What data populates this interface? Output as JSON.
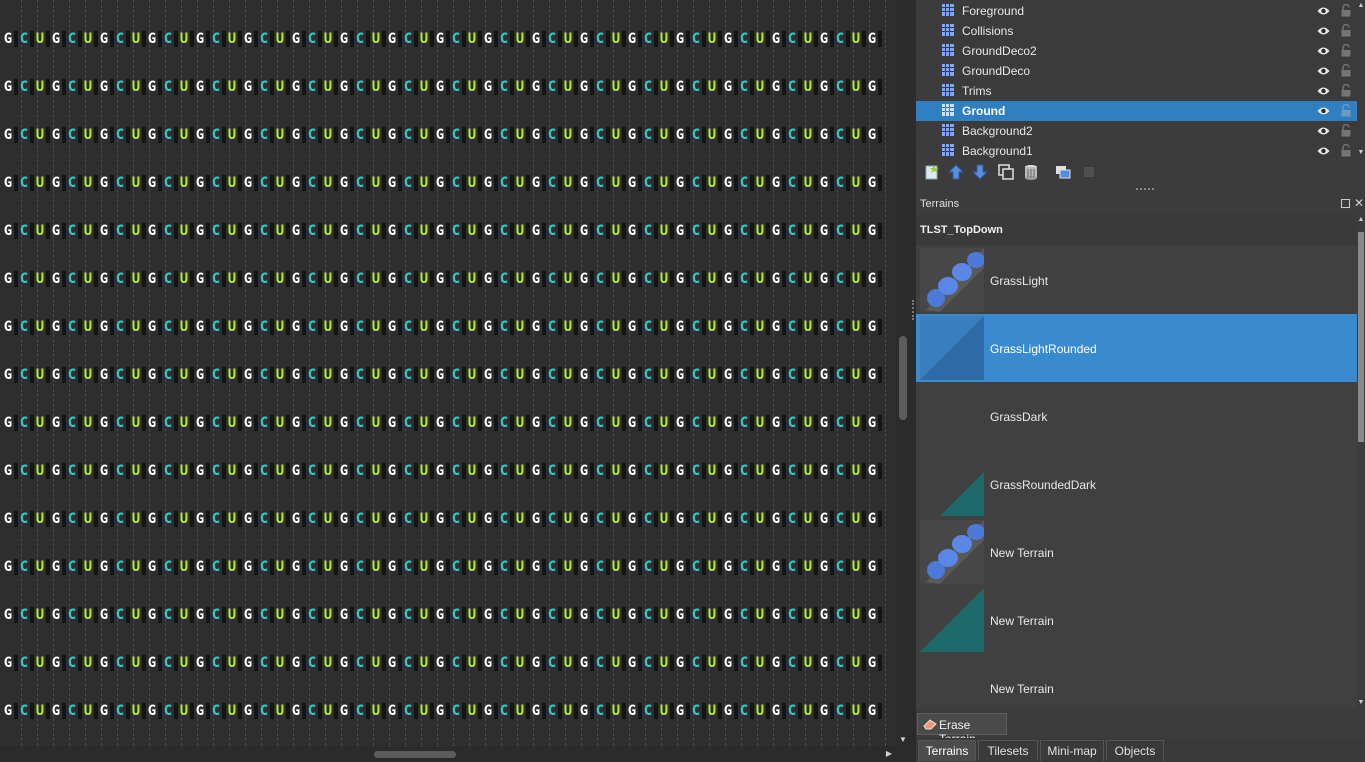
{
  "map": {
    "pattern": [
      "G",
      "C",
      "U"
    ],
    "row_count": 15,
    "triplet_count": 19
  },
  "layers": {
    "items": [
      {
        "name": "Foreground",
        "selected": false
      },
      {
        "name": "Collisions",
        "selected": false
      },
      {
        "name": "GroundDeco2",
        "selected": false
      },
      {
        "name": "GroundDeco",
        "selected": false
      },
      {
        "name": "Trims",
        "selected": false
      },
      {
        "name": "Ground",
        "selected": true
      },
      {
        "name": "Background2",
        "selected": false
      },
      {
        "name": "Background1",
        "selected": false
      }
    ]
  },
  "layer_toolbar": {
    "icons": [
      "new-layer-icon",
      "move-layer-up-icon",
      "move-layer-down-icon",
      "duplicate-layer-icon",
      "delete-layer-icon",
      "merge-layer-icon",
      "layer-properties-icon"
    ]
  },
  "terrains_panel": {
    "title": "Terrains",
    "tileset_name": "TLST_TopDown",
    "items": [
      {
        "name": "GrassLight",
        "thumb": "blob-blue",
        "selected": false
      },
      {
        "name": "GrassLightRounded",
        "thumb": "triangle-blue",
        "selected": true
      },
      {
        "name": "GrassDark",
        "thumb": "none",
        "selected": false
      },
      {
        "name": "GrassRoundedDark",
        "thumb": "triangle-teal-small",
        "selected": false
      },
      {
        "name": "New Terrain",
        "thumb": "blob-blue",
        "selected": false
      },
      {
        "name": "New Terrain",
        "thumb": "triangle-teal",
        "selected": false
      },
      {
        "name": "New Terrain",
        "thumb": "none",
        "selected": false
      }
    ],
    "erase_label": "Erase Terrain"
  },
  "tabs": [
    {
      "label": "Terrains",
      "active": true
    },
    {
      "label": "Tilesets",
      "active": false
    },
    {
      "label": "Mini-map",
      "active": false
    },
    {
      "label": "Objects",
      "active": false
    }
  ],
  "colors": {
    "selection": "#2f7fc1",
    "tile_white": "#ffffff",
    "tile_cyan": "#2ad0d8",
    "tile_green": "#b2ec3c"
  }
}
